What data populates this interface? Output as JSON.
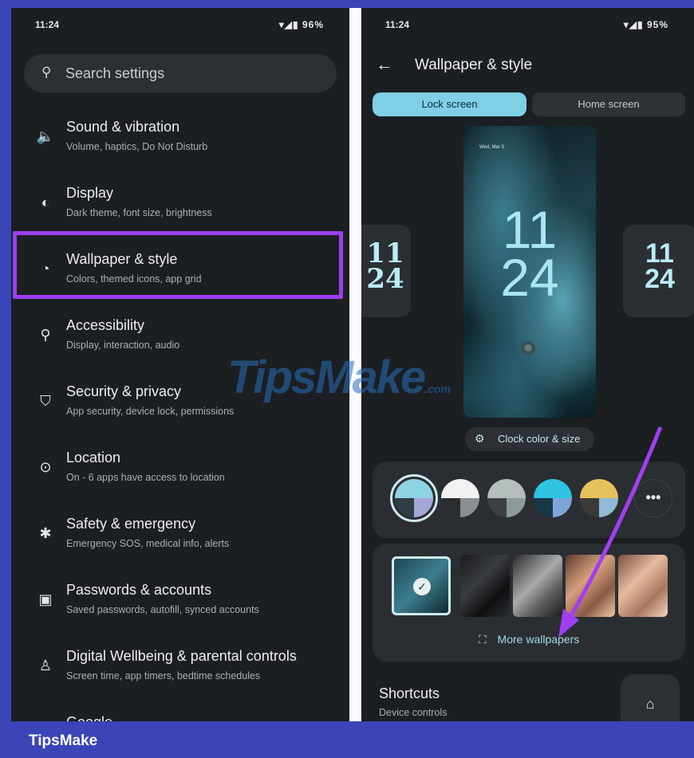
{
  "left_screen": {
    "status": {
      "time": "11:24",
      "icons": "▾◢▮",
      "battery": "96%"
    },
    "search": {
      "placeholder": "Search settings"
    },
    "items": [
      {
        "icon": "speaker-icon",
        "glyph": "🔈",
        "title": "Sound & vibration",
        "subtitle": "Volume, haptics, Do Not Disturb"
      },
      {
        "icon": "display-icon",
        "glyph": "◐",
        "title": "Display",
        "subtitle": "Dark theme, font size, brightness"
      },
      {
        "icon": "palette-icon",
        "glyph": "🎨",
        "title": "Wallpaper & style",
        "subtitle": "Colors, themed icons, app grid"
      },
      {
        "icon": "accessibility-icon",
        "glyph": "♿",
        "title": "Accessibility",
        "subtitle": "Display, interaction, audio"
      },
      {
        "icon": "shield-icon",
        "glyph": "⛨",
        "title": "Security & privacy",
        "subtitle": "App security, device lock, permissions"
      },
      {
        "icon": "location-icon",
        "glyph": "⊙",
        "title": "Location",
        "subtitle": "On - 6 apps have access to location"
      },
      {
        "icon": "asterisk-icon",
        "glyph": "✱",
        "title": "Safety & emergency",
        "subtitle": "Emergency SOS, medical info, alerts"
      },
      {
        "icon": "key-icon",
        "glyph": "▣",
        "title": "Passwords & accounts",
        "subtitle": "Saved passwords, autofill, synced accounts"
      },
      {
        "icon": "wellbeing-icon",
        "glyph": "♙",
        "title": "Digital Wellbeing & parental controls",
        "subtitle": "Screen time, app timers, bedtime schedules"
      },
      {
        "icon": "google-icon",
        "glyph": "G",
        "title": "Google",
        "subtitle": ""
      }
    ]
  },
  "right_screen": {
    "status": {
      "time": "11:24",
      "icons": "▾◢▮",
      "battery": "95%"
    },
    "title": "Wallpaper & style",
    "tabs": {
      "lock": "Lock screen",
      "home": "Home screen"
    },
    "preview": {
      "date": "Wed, Mar 9",
      "clock": "11\n24"
    },
    "side_clock_left": "11\n24",
    "side_clock_right": "11\n24",
    "clock_button": "Clock color & size",
    "swatches": [
      {
        "top": "#8ed3e3",
        "bl": "#2f3d44",
        "br": "#a5a6d6",
        "selected": true
      },
      {
        "top": "#f1f1f1",
        "bl": "#2a2c2e",
        "br": "#8a8e91",
        "selected": false
      },
      {
        "top": "#b6bdbd",
        "bl": "#3b4142",
        "br": "#8a9b9a",
        "selected": false
      },
      {
        "top": "#2fc4e3",
        "bl": "#153845",
        "br": "#7fa4d8",
        "selected": false
      },
      {
        "top": "#e6c25a",
        "bl": "#3c3a36",
        "br": "#8fb9d6",
        "selected": false
      }
    ],
    "more_swatches": "•••",
    "more_wallpapers": "More wallpapers",
    "shortcuts": {
      "title": "Shortcuts",
      "subtitle": "Device controls"
    }
  },
  "watermark": "TipsMake",
  "watermark_suffix": ".com",
  "footer": {
    "brand": "TipsMake"
  },
  "colors": {
    "highlight": "#9d3ff0",
    "accent": "#7fd0e6",
    "frame": "#3a45b8"
  }
}
